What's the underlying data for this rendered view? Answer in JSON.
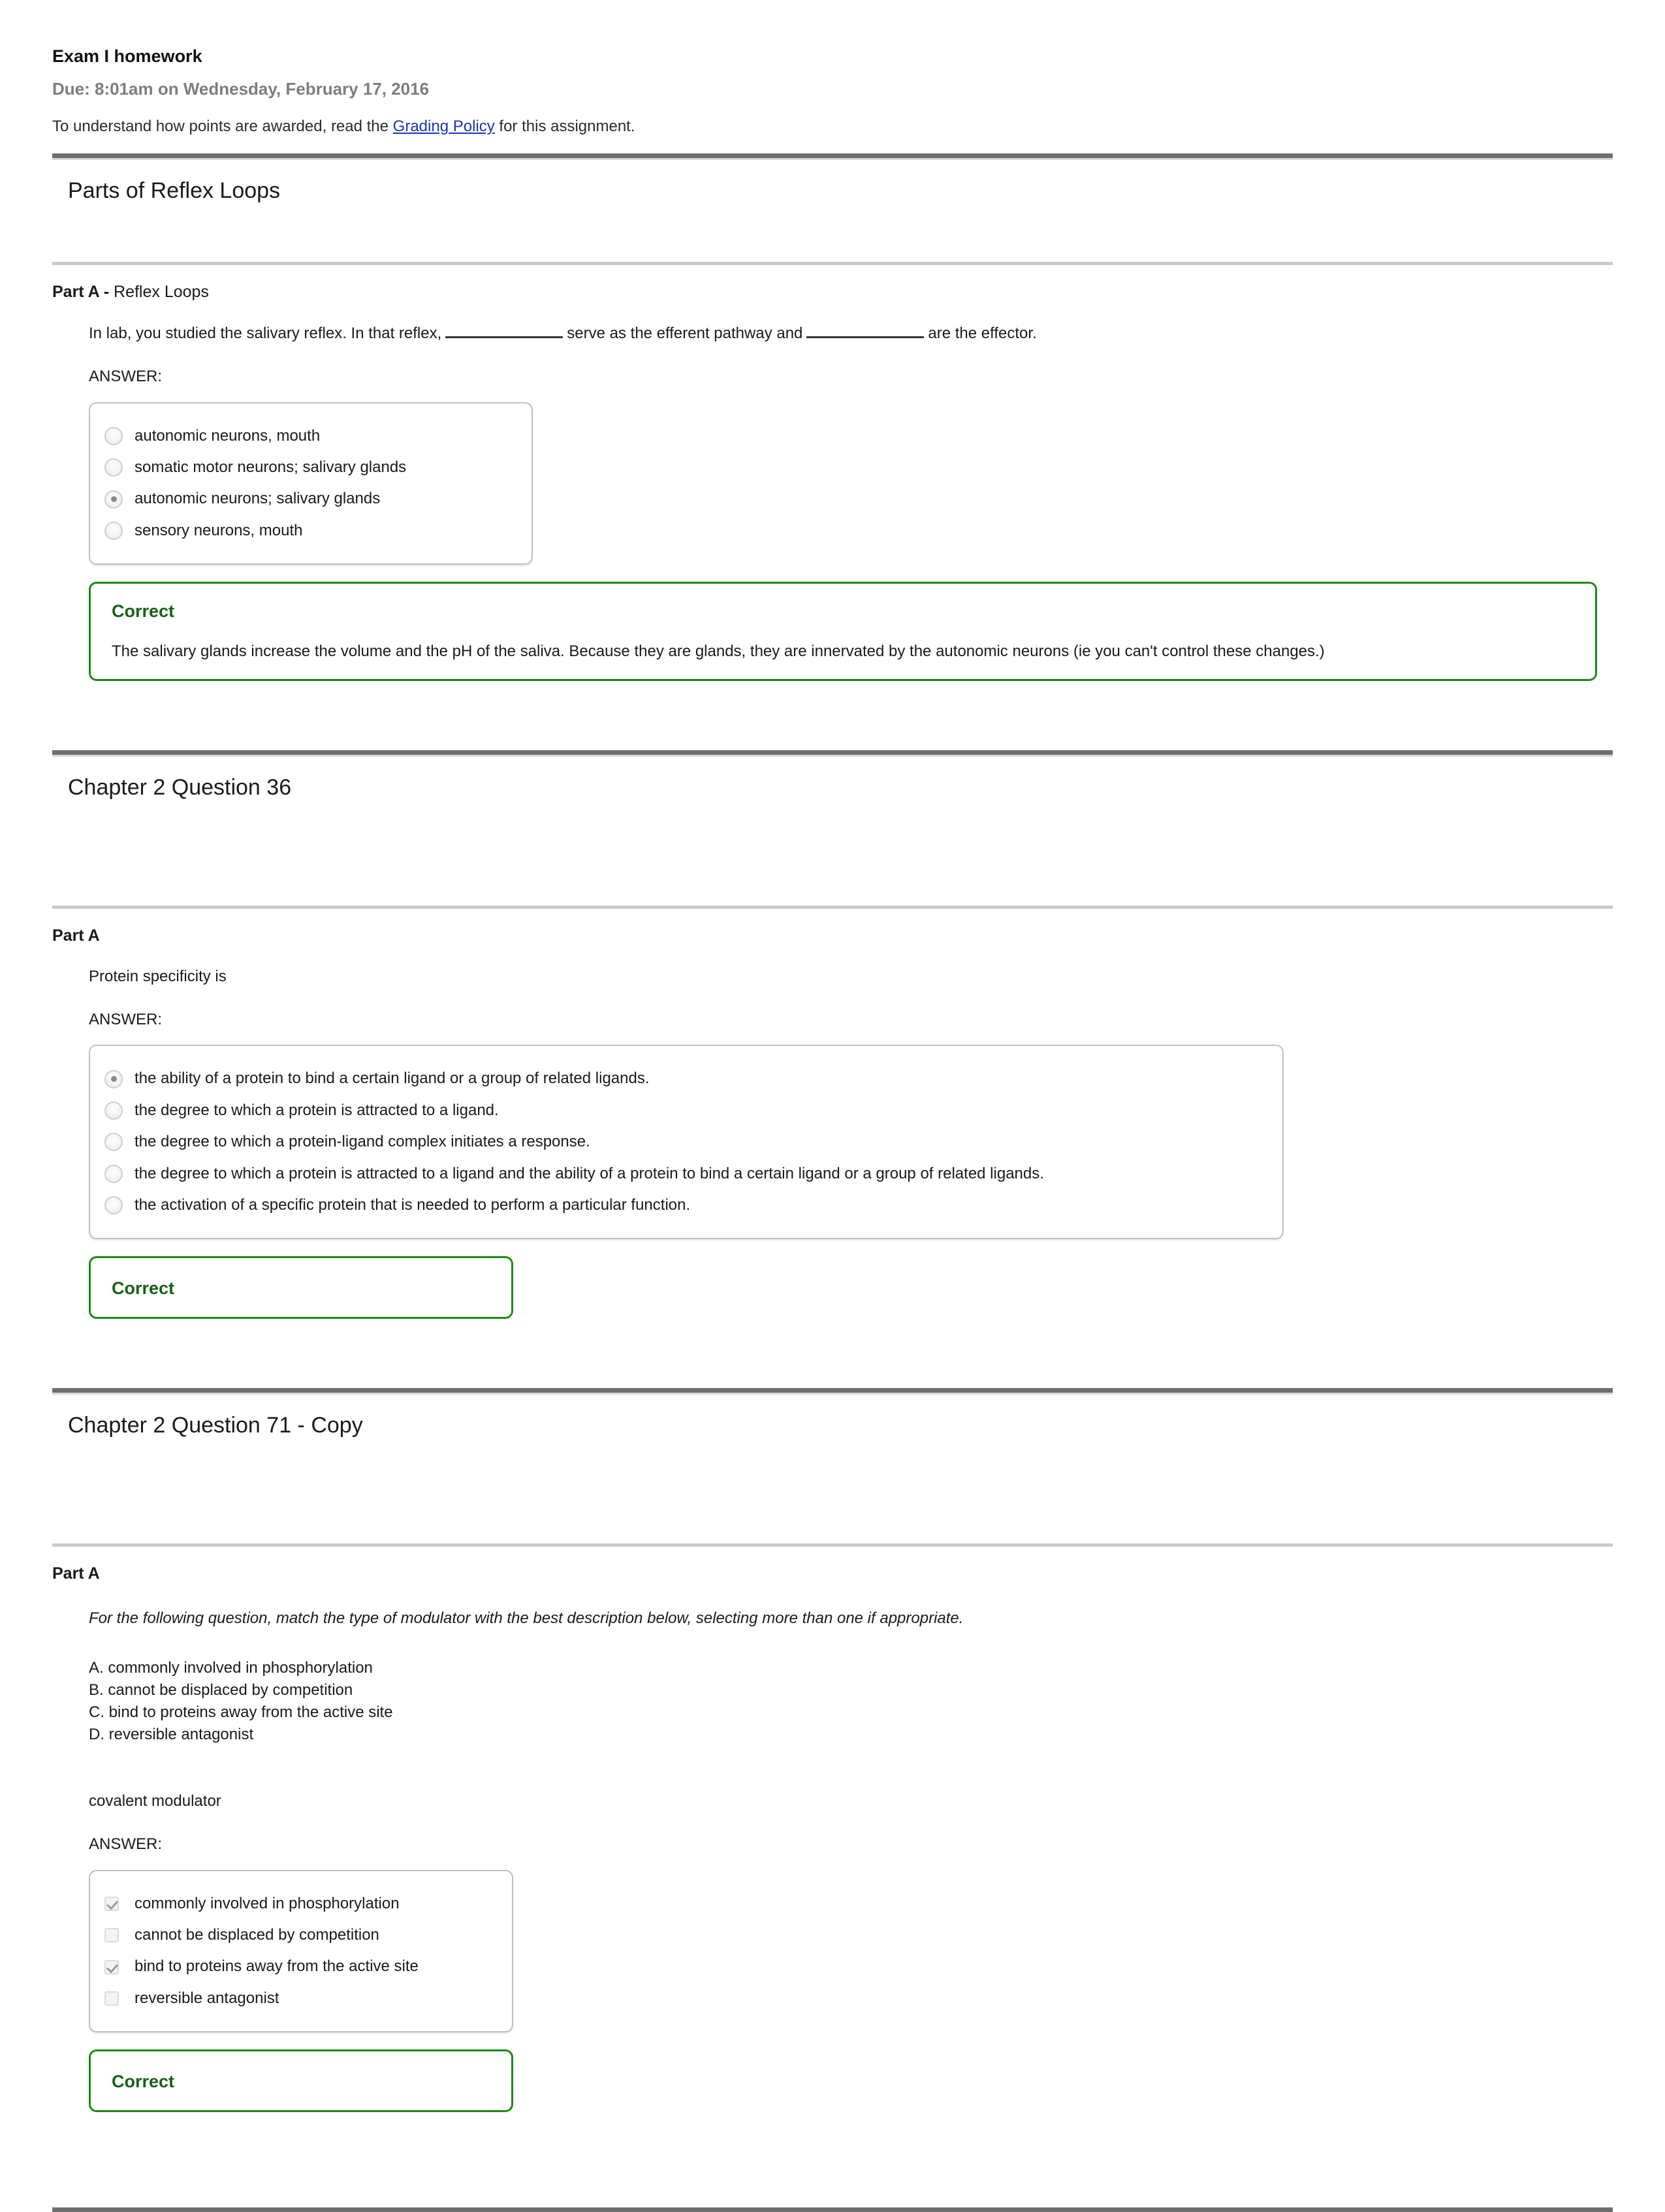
{
  "assignment": {
    "title": "Exam I homework",
    "due": "Due: 8:01am on Wednesday, February 17, 2016",
    "note_prefix": "To understand how points are awarded, read the ",
    "note_link": "Grading Policy",
    "note_suffix": " for this assignment."
  },
  "colors": {
    "correct_green": "#176217",
    "feedback_border": "#1b8a14",
    "link_blue": "#1a35b0",
    "rule_dark": "#6e6e6e",
    "rule_light": "#c9c9c9",
    "muted_text": "#7d7d7d"
  },
  "problems": [
    {
      "title": "Parts of Reflex Loops",
      "part_label": "Part A -",
      "part_sublabel": " Reflex Loops",
      "question_pre": "In lab, you studied the salivary reflex.  In that reflex,",
      "question_mid": "serve as the efferent pathway and",
      "question_post": "are the effector.",
      "answer_label": "ANSWER:",
      "input_type": "radio",
      "options": [
        {
          "label": "autonomic neurons, mouth",
          "selected": false
        },
        {
          "label": "somatic motor neurons; salivary glands",
          "selected": false
        },
        {
          "label": "autonomic neurons; salivary glands",
          "selected": true
        },
        {
          "label": "sensory neurons, mouth",
          "selected": false
        }
      ],
      "feedback": {
        "title": "Correct",
        "text": "The salivary glands increase the volume and the pH of the saliva.  Because they are glands, they are innervated by the autonomic neurons (ie you can't control these changes.)"
      }
    },
    {
      "title": "Chapter 2 Question 36",
      "part_label": "Part A",
      "part_sublabel": "",
      "question": "Protein specificity is",
      "answer_label": "ANSWER:",
      "input_type": "radio",
      "options": [
        {
          "label": "the ability of a protein to bind a certain ligand or a group of related ligands.",
          "selected": true
        },
        {
          "label": "the degree to which a protein is attracted to a ligand.",
          "selected": false
        },
        {
          "label": "the degree to which a protein-ligand complex initiates a response.",
          "selected": false
        },
        {
          "label": "the degree to which a protein is attracted to a ligand and the ability of a protein to bind a certain ligand or a group of related ligands.",
          "selected": false
        },
        {
          "label": "the activation of a specific protein that is needed to perform a particular function.",
          "selected": false
        }
      ],
      "feedback": {
        "title": "Correct",
        "text": ""
      }
    },
    {
      "title": "Chapter 2 Question 71 - Copy",
      "part_label": "Part A",
      "part_sublabel": "",
      "instruction": "For the following question, match the type of modulator with the best description below, selecting more than one if appropriate.",
      "choice_key": "A. commonly involved in phosphorylation\nB. cannot be displaced by competition\nC. bind to proteins away from the active site\nD. reversible antagonist",
      "prompt": "covalent modulator",
      "answer_label": "ANSWER:",
      "input_type": "checkbox",
      "options": [
        {
          "label": "commonly involved in phosphorylation",
          "selected": true
        },
        {
          "label": "cannot be displaced by competition",
          "selected": false
        },
        {
          "label": "bind to proteins away from the active site",
          "selected": true
        },
        {
          "label": "reversible antagonist",
          "selected": false
        }
      ],
      "feedback": {
        "title": "Correct",
        "text": ""
      }
    }
  ]
}
